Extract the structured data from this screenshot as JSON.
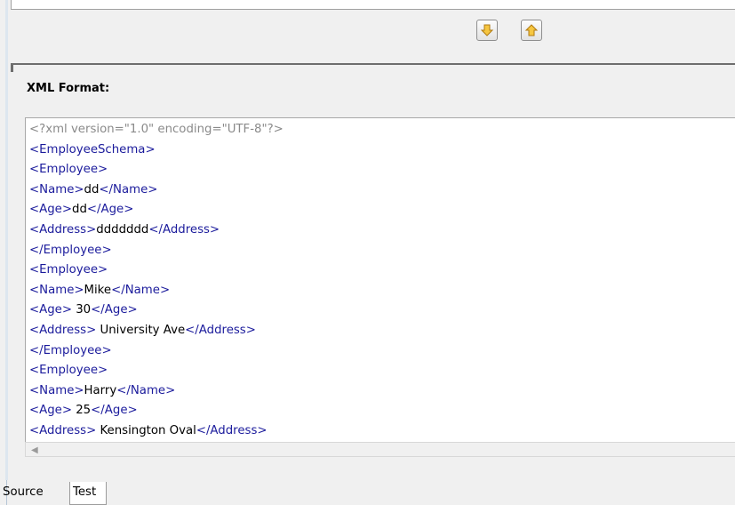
{
  "section": {
    "title": "XML Format:"
  },
  "buttons": {
    "move_down_icon": "arrow-down-icon",
    "move_up_icon": "arrow-up-icon"
  },
  "xml_lines": [
    {
      "kind": "decl",
      "text": "<?xml version=\"1.0\" encoding=\"UTF-8\"?>"
    },
    {
      "kind": "tag",
      "open": "<EmployeeSchema>"
    },
    {
      "kind": "tag",
      "open": "<Employee>"
    },
    {
      "kind": "elem",
      "open": "<Name>",
      "value": "dd",
      "close": "</Name>"
    },
    {
      "kind": "elem",
      "open": "<Age>",
      "value": "dd",
      "close": "</Age>"
    },
    {
      "kind": "elem",
      "open": "<Address>",
      "value": "ddddddd",
      "close": "</Address>"
    },
    {
      "kind": "tag",
      "open": "</Employee>"
    },
    {
      "kind": "tag",
      "open": "<Employee>"
    },
    {
      "kind": "elem",
      "open": "<Name>",
      "value": "Mike",
      "close": "</Name>"
    },
    {
      "kind": "elem",
      "open": "<Age>",
      "value": " 30",
      "close": "</Age>"
    },
    {
      "kind": "elem",
      "open": "<Address>",
      "value": " University Ave",
      "close": "</Address>"
    },
    {
      "kind": "tag",
      "open": "</Employee>"
    },
    {
      "kind": "tag",
      "open": "<Employee>"
    },
    {
      "kind": "elem",
      "open": "<Name>",
      "value": "Harry",
      "close": "</Name>"
    },
    {
      "kind": "elem",
      "open": "<Age>",
      "value": " 25",
      "close": "</Age>"
    },
    {
      "kind": "elem",
      "open": "<Address>",
      "value": " Kensington Oval",
      "close": "</Address>"
    }
  ],
  "tabs": [
    {
      "label": "Source"
    },
    {
      "label": "Test"
    }
  ],
  "colors": {
    "tag": "#1b1b9c",
    "declaration": "#8a8a8a",
    "text": "#000000"
  }
}
